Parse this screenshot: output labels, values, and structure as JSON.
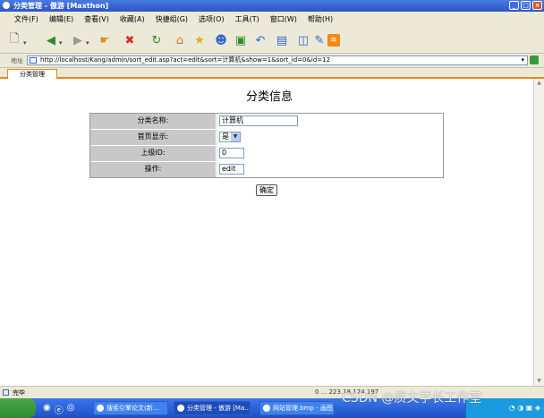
{
  "window": {
    "title": "分类管理 - 傲游 [Maxthon]"
  },
  "menu": [
    "文件(F)",
    "编辑(E)",
    "查看(V)",
    "收藏(A)",
    "快捷组(G)",
    "选项(O)",
    "工具(T)",
    "窗口(W)",
    "帮助(H)"
  ],
  "address": {
    "label": "地址",
    "url": "http://localhost/Kang/admin/sort_edit.asp?act=edit&sort=计算机&show=1&sort_id=0&id=12"
  },
  "tab": {
    "label": "分类管理"
  },
  "page": {
    "heading": "分类信息",
    "fields": [
      {
        "label": "分类名称:",
        "value": "计算机"
      },
      {
        "label": "首页显示:",
        "value": "是"
      },
      {
        "label": "上级ID:",
        "value": "0"
      },
      {
        "label": "操作:",
        "value": "edit"
      }
    ],
    "submit_label": "确定"
  },
  "status": {
    "text": "完毕",
    "right": "0 ... 223.18.174.197"
  },
  "taskbar": {
    "tasks": [
      {
        "label": "搜索引擎论文(新..."
      },
      {
        "label": "分类管理 - 傲游 [Ma..."
      },
      {
        "label": "网站管理.bmp - 画图"
      }
    ]
  },
  "watermark": "CSDN @质文学长工作室"
}
